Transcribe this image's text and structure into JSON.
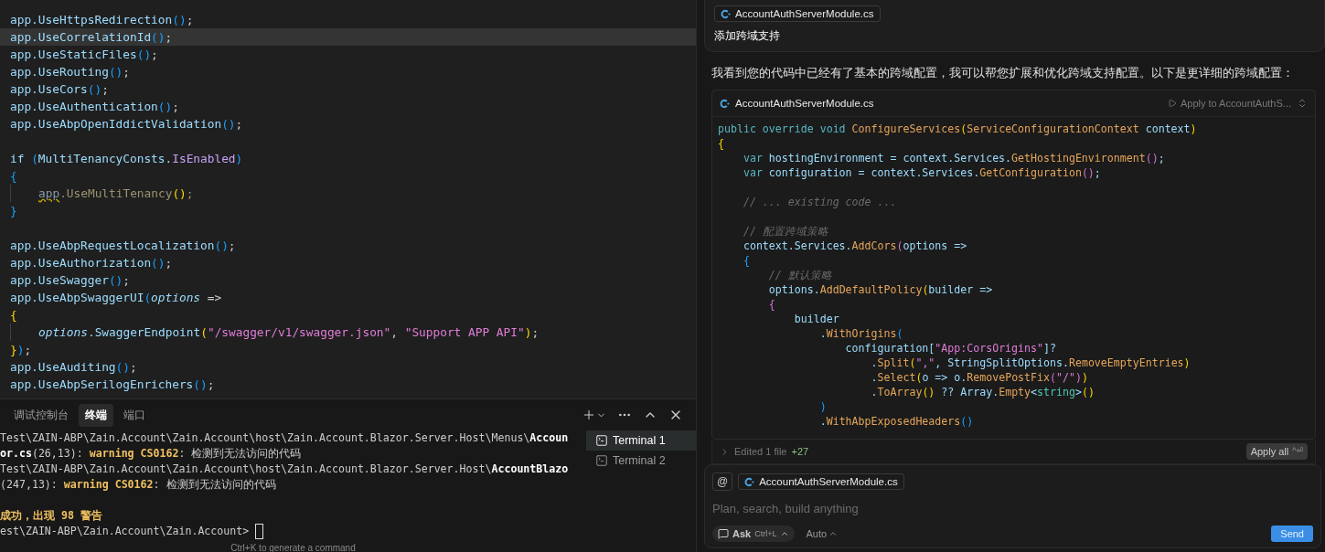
{
  "editor": {
    "lines": [
      {
        "kind": "code",
        "current": false,
        "segs": [
          {
            "kind": "id",
            "t": "app.UseHttpsRedirection"
          },
          {
            "kind": "paren",
            "t": "()"
          },
          {
            "kind": "punc",
            "t": ";"
          }
        ]
      },
      {
        "kind": "code",
        "current": true,
        "segs": [
          {
            "kind": "id",
            "t": "app.UseCorrelationId"
          },
          {
            "kind": "paren",
            "t": "()"
          },
          {
            "kind": "punc",
            "t": ";"
          }
        ]
      },
      {
        "kind": "code",
        "current": false,
        "segs": [
          {
            "kind": "id",
            "t": "app.UseStaticFiles"
          },
          {
            "kind": "paren",
            "t": "()"
          },
          {
            "kind": "punc",
            "t": ";"
          }
        ]
      },
      {
        "kind": "code",
        "current": false,
        "segs": [
          {
            "kind": "id",
            "t": "app.UseRouting"
          },
          {
            "kind": "paren",
            "t": "()"
          },
          {
            "kind": "punc",
            "t": ";"
          }
        ]
      },
      {
        "kind": "code",
        "current": false,
        "segs": [
          {
            "kind": "id",
            "t": "app.UseCors"
          },
          {
            "kind": "paren",
            "t": "()"
          },
          {
            "kind": "punc",
            "t": ";"
          }
        ]
      },
      {
        "kind": "code",
        "current": false,
        "segs": [
          {
            "kind": "id",
            "t": "app.UseAuthentication"
          },
          {
            "kind": "paren",
            "t": "()"
          },
          {
            "kind": "punc",
            "t": ";"
          }
        ]
      },
      {
        "kind": "code",
        "current": false,
        "segs": [
          {
            "kind": "id",
            "t": "app.UseAbpOpenIddictValidation"
          },
          {
            "kind": "paren",
            "t": "()"
          },
          {
            "kind": "punc",
            "t": ";"
          }
        ]
      },
      {
        "kind": "blank"
      },
      {
        "kind": "code",
        "current": false,
        "segs": [
          {
            "kind": "id",
            "t": "if "
          },
          {
            "kind": "paren",
            "t": "("
          },
          {
            "kind": "id",
            "t": "MultiTenancyConsts."
          },
          {
            "kind": "prop",
            "t": "IsEnabled"
          },
          {
            "kind": "paren",
            "t": ")"
          }
        ]
      },
      {
        "kind": "code",
        "current": false,
        "segs": [
          {
            "kind": "paren",
            "t": "{"
          }
        ]
      },
      {
        "kind": "indented",
        "current": false,
        "segs": [
          {
            "kind": "warnu",
            "t": "app"
          },
          {
            "kind": "dim",
            "t": ".UseMultiTenancy"
          },
          {
            "kind": "brace",
            "t": "()"
          },
          {
            "kind": "dim",
            "t": ";"
          }
        ]
      },
      {
        "kind": "code",
        "current": false,
        "segs": [
          {
            "kind": "paren",
            "t": "}"
          }
        ]
      },
      {
        "kind": "blank"
      },
      {
        "kind": "code",
        "current": false,
        "segs": [
          {
            "kind": "id",
            "t": "app.UseAbpRequestLocalization"
          },
          {
            "kind": "paren",
            "t": "()"
          },
          {
            "kind": "punc",
            "t": ";"
          }
        ]
      },
      {
        "kind": "code",
        "current": false,
        "segs": [
          {
            "kind": "id",
            "t": "app.UseAuthorization"
          },
          {
            "kind": "paren",
            "t": "()"
          },
          {
            "kind": "punc",
            "t": ";"
          }
        ]
      },
      {
        "kind": "code",
        "current": false,
        "segs": [
          {
            "kind": "id",
            "t": "app.UseSwagger"
          },
          {
            "kind": "paren",
            "t": "()"
          },
          {
            "kind": "punc",
            "t": ";"
          }
        ]
      },
      {
        "kind": "code",
        "current": false,
        "segs": [
          {
            "kind": "id",
            "t": "app.UseAbpSwaggerUI"
          },
          {
            "kind": "paren",
            "t": "("
          },
          {
            "kind": "it",
            "t": "options"
          },
          {
            "kind": "punc",
            "t": " =>"
          }
        ]
      },
      {
        "kind": "code",
        "current": false,
        "segs": [
          {
            "kind": "brace",
            "t": "{"
          }
        ]
      },
      {
        "kind": "indented",
        "current": false,
        "segs": [
          {
            "kind": "it",
            "t": "options"
          },
          {
            "kind": "id",
            "t": ".SwaggerEndpoint"
          },
          {
            "kind": "brace",
            "t": "("
          },
          {
            "kind": "str",
            "t": "\"/swagger/v1/swagger.json\""
          },
          {
            "kind": "punc",
            "t": ", "
          },
          {
            "kind": "str",
            "t": "\"Support APP API\""
          },
          {
            "kind": "brace",
            "t": ")"
          },
          {
            "kind": "punc",
            "t": ";"
          }
        ]
      },
      {
        "kind": "code",
        "current": false,
        "segs": [
          {
            "kind": "brace",
            "t": "}"
          },
          {
            "kind": "paren",
            "t": ")"
          },
          {
            "kind": "punc",
            "t": ";"
          }
        ]
      },
      {
        "kind": "code",
        "current": false,
        "segs": [
          {
            "kind": "id",
            "t": "app.UseAuditing"
          },
          {
            "kind": "paren",
            "t": "()"
          },
          {
            "kind": "punc",
            "t": ";"
          }
        ]
      },
      {
        "kind": "code",
        "current": false,
        "segs": [
          {
            "kind": "id",
            "t": "app.UseAbpSerilogEnrichers"
          },
          {
            "kind": "paren",
            "t": "()"
          },
          {
            "kind": "punc",
            "t": ";"
          }
        ]
      }
    ]
  },
  "panel": {
    "tabs": [
      {
        "label": "调试控制台",
        "selected": false
      },
      {
        "label": "终端",
        "selected": true
      },
      {
        "label": "端口",
        "selected": false
      }
    ],
    "output": [
      {
        "kind": "text",
        "segs": [
          {
            "kind": "plain",
            "t": "Test\\ZAIN-ABP\\Zain.Account\\Zain.Account\\host\\Zain.Account.Blazor.Server.Host\\Menus\\"
          },
          {
            "kind": "bold",
            "t": "Accoun"
          }
        ]
      },
      {
        "kind": "text",
        "segs": [
          {
            "kind": "bold",
            "t": "or.cs"
          },
          {
            "kind": "plain",
            "t": "(26,13): "
          },
          {
            "kind": "warn",
            "t": "warning CS0162"
          },
          {
            "kind": "plain",
            "t": ": 检测到无法访问的代码"
          }
        ]
      },
      {
        "kind": "text",
        "segs": [
          {
            "kind": "plain",
            "t": "Test\\ZAIN-ABP\\Zain.Account\\Zain.Account\\host\\Zain.Account.Blazor.Server.Host\\"
          },
          {
            "kind": "bold",
            "t": "AccountBlazo"
          }
        ]
      },
      {
        "kind": "text",
        "segs": [
          {
            "kind": "plain",
            "t": "(247,13): "
          },
          {
            "kind": "warn",
            "t": "warning CS0162"
          },
          {
            "kind": "plain",
            "t": ": 检测到无法访问的代码"
          }
        ]
      },
      {
        "kind": "blank"
      },
      {
        "kind": "text",
        "segs": [
          {
            "kind": "warn",
            "t": "成功，出现 98 警告"
          }
        ]
      },
      {
        "kind": "prompt",
        "segs": [
          {
            "kind": "plain",
            "t": "est\\ZAIN-ABP\\Zain.Account\\Zain.Account> "
          }
        ]
      }
    ],
    "hint": "Ctrl+K to generate a command",
    "terminals": [
      {
        "label": "Terminal 1",
        "selected": true
      },
      {
        "label": "Terminal 2",
        "selected": false
      }
    ]
  },
  "chat": {
    "request": {
      "file": "AccountAuthServerModule.cs",
      "text": "添加跨域支持"
    },
    "answer": "我看到您的代码中已经有了基本的跨域配置，我可以帮您扩展和优化跨域支持配置。以下是更详细的跨域配置：",
    "code_block": {
      "file": "AccountAuthServerModule.cs",
      "apply": "Apply to AccountAuthS...",
      "lines": [
        {
          "kind": "code",
          "segs": [
            {
              "kind": "kw",
              "t": "public override void "
            },
            {
              "kind": "fn",
              "t": "ConfigureServices"
            },
            {
              "kind": "p1",
              "t": "("
            },
            {
              "kind": "fn",
              "t": "ServiceConfigurationContext"
            },
            {
              "kind": "id",
              "t": " context"
            },
            {
              "kind": "p1",
              "t": ")"
            }
          ]
        },
        {
          "kind": "code",
          "segs": [
            {
              "kind": "p1",
              "t": "{"
            }
          ]
        },
        {
          "kind": "code",
          "segs": [
            {
              "kind": "kw",
              "t": "    var "
            },
            {
              "kind": "id",
              "t": "hostingEnvironment = context.Services."
            },
            {
              "kind": "fn",
              "t": "GetHostingEnvironment"
            },
            {
              "kind": "p2",
              "t": "()"
            },
            {
              "kind": "id",
              "t": ";"
            }
          ]
        },
        {
          "kind": "code",
          "segs": [
            {
              "kind": "kw",
              "t": "    var "
            },
            {
              "kind": "id",
              "t": "configuration = context.Services."
            },
            {
              "kind": "fn",
              "t": "GetConfiguration"
            },
            {
              "kind": "p2",
              "t": "()"
            },
            {
              "kind": "id",
              "t": ";"
            }
          ]
        },
        {
          "kind": "blank"
        },
        {
          "kind": "code",
          "segs": [
            {
              "kind": "cm",
              "t": "    // ... existing code ..."
            }
          ]
        },
        {
          "kind": "blank"
        },
        {
          "kind": "code",
          "segs": [
            {
              "kind": "cm",
              "t": "    // 配置跨域策略"
            }
          ]
        },
        {
          "kind": "code",
          "segs": [
            {
              "kind": "id",
              "t": "    context.Services."
            },
            {
              "kind": "fn",
              "t": "AddCors"
            },
            {
              "kind": "p2",
              "t": "("
            },
            {
              "kind": "id",
              "t": "options =>"
            }
          ]
        },
        {
          "kind": "code",
          "segs": [
            {
              "kind": "p3",
              "t": "    {"
            }
          ]
        },
        {
          "kind": "code",
          "segs": [
            {
              "kind": "cm",
              "t": "        // 默认策略"
            }
          ]
        },
        {
          "kind": "code",
          "segs": [
            {
              "kind": "id",
              "t": "        options."
            },
            {
              "kind": "fn",
              "t": "AddDefaultPolicy"
            },
            {
              "kind": "p1",
              "t": "("
            },
            {
              "kind": "id",
              "t": "builder =>"
            }
          ]
        },
        {
          "kind": "code",
          "segs": [
            {
              "kind": "p2",
              "t": "        {"
            }
          ]
        },
        {
          "kind": "code",
          "segs": [
            {
              "kind": "var",
              "t": "            builder"
            }
          ]
        },
        {
          "kind": "code",
          "segs": [
            {
              "kind": "id",
              "t": "                ."
            },
            {
              "kind": "fn",
              "t": "WithOrigins"
            },
            {
              "kind": "p3",
              "t": "("
            }
          ]
        },
        {
          "kind": "code",
          "segs": [
            {
              "kind": "id",
              "t": "                    configuration["
            },
            {
              "kind": "str",
              "t": "\"App:CorsOrigins\""
            },
            {
              "kind": "id",
              "t": "]?"
            }
          ]
        },
        {
          "kind": "code",
          "segs": [
            {
              "kind": "id",
              "t": "                        ."
            },
            {
              "kind": "fn",
              "t": "Split"
            },
            {
              "kind": "p1",
              "t": "("
            },
            {
              "kind": "str",
              "t": "\",\""
            },
            {
              "kind": "id",
              "t": ", StringSplitOptions."
            },
            {
              "kind": "fn",
              "t": "RemoveEmptyEntries"
            },
            {
              "kind": "p1",
              "t": ")"
            }
          ]
        },
        {
          "kind": "code",
          "segs": [
            {
              "kind": "id",
              "t": "                        ."
            },
            {
              "kind": "fn",
              "t": "Select"
            },
            {
              "kind": "p1",
              "t": "("
            },
            {
              "kind": "id",
              "t": "o => o."
            },
            {
              "kind": "fn",
              "t": "RemovePostFix"
            },
            {
              "kind": "p2",
              "t": "("
            },
            {
              "kind": "str",
              "t": "\"/\""
            },
            {
              "kind": "p2",
              "t": ")"
            },
            {
              "kind": "p1",
              "t": ")"
            }
          ]
        },
        {
          "kind": "code",
          "segs": [
            {
              "kind": "id",
              "t": "                        ."
            },
            {
              "kind": "fn",
              "t": "ToArray"
            },
            {
              "kind": "p1",
              "t": "()"
            },
            {
              "kind": "id",
              "t": " ?? Array."
            },
            {
              "kind": "fn",
              "t": "Empty"
            },
            {
              "kind": "id",
              "t": "<"
            },
            {
              "kind": "tp",
              "t": "string"
            },
            {
              "kind": "id",
              "t": ">"
            },
            {
              "kind": "p1",
              "t": "()"
            }
          ]
        },
        {
          "kind": "code",
          "segs": [
            {
              "kind": "p3",
              "t": "                )"
            }
          ]
        },
        {
          "kind": "code",
          "segs": [
            {
              "kind": "id",
              "t": "                ."
            },
            {
              "kind": "fn",
              "t": "WithAbpExposedHeaders"
            },
            {
              "kind": "p3",
              "t": "()"
            }
          ]
        }
      ]
    },
    "changes": {
      "label": "Edited 1 file",
      "added": "+27",
      "apply_all": "Apply all",
      "shortcut": "^⏎"
    },
    "composer": {
      "mention": "@",
      "file": "AccountAuthServerModule.cs",
      "placeholder": "Plan, search, build anything",
      "mode": "Ask",
      "mode_shortcut": "Ctrl+L",
      "model": "Auto",
      "send": "Send"
    }
  }
}
